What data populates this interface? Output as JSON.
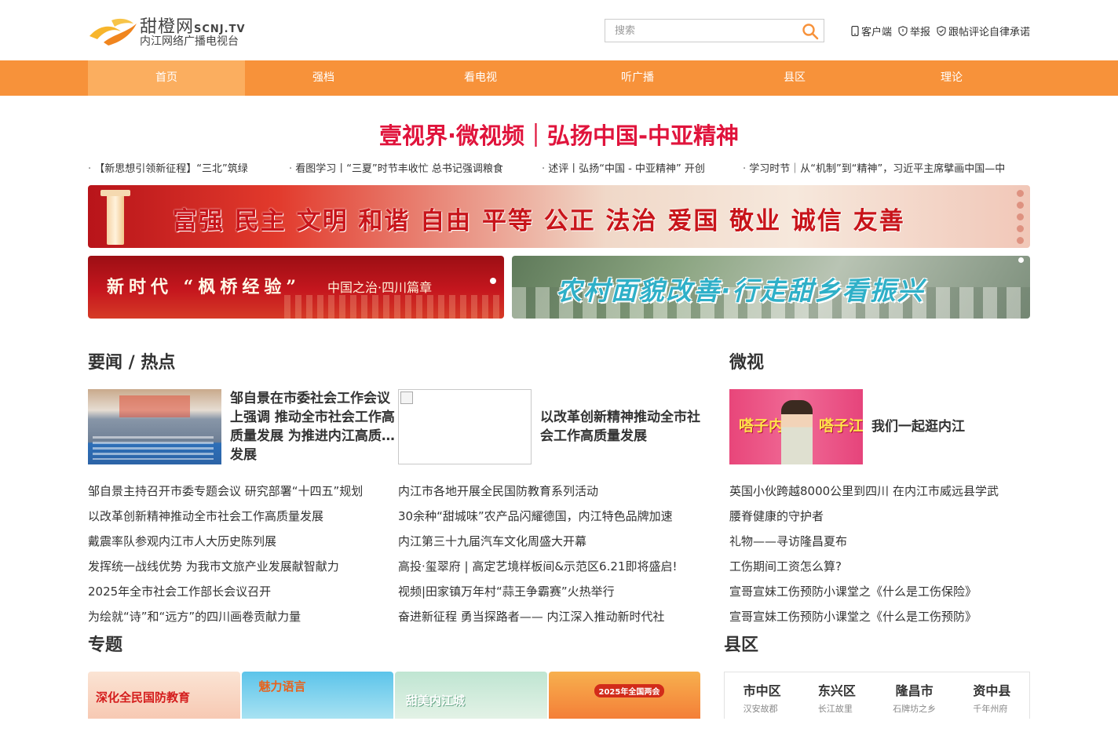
{
  "header": {
    "logo_name": "甜橙网",
    "logo_domain": "SCNJ.TV",
    "logo_subtitle": "内江网络广播电视台",
    "search_placeholder": "搜索",
    "links": [
      "客户端",
      "举报",
      "跟帖评论自律承诺"
    ]
  },
  "nav": {
    "items": [
      "首页",
      "强档",
      "看电视",
      "听广播",
      "县区",
      "理论"
    ],
    "active_index": 0
  },
  "headline": "壹视界·微视频｜弘扬中国-中亚精神",
  "ticker": [
    "【新思想引领新征程】“三北”筑绿",
    "看图学习丨“三夏”时节丰收忙 总书记强调粮食",
    "述评丨弘扬“中国 - 中亚精神” 开创",
    "学习时节｜从“机制”到“精神”，习近平主席擘画中国—中"
  ],
  "banners": {
    "values": "富强 民主 文明 和谐 自由 平等 公正 法治 爱国 敬业 诚信 友善",
    "fengqiao_main": "新时代 “枫桥经验”",
    "fengqiao_sub": "中国之治·四川篇章",
    "rural": "农村面貌改善·行走甜乡看振兴"
  },
  "news": {
    "title": "要闻 / 热点",
    "features": [
      "邹自景在市委社会工作会议上强调 推动全市社会工作高质量发展 为推进内江高质量发展",
      "以改革创新精神推动全市社会工作高质量发展"
    ],
    "list_left": [
      "邹自景主持召开市委专题会议 研究部署“十四五”规划",
      "以改革创新精神推动全市社会工作高质量发展",
      "戴震率队参观内江市人大历史陈列展",
      "发挥统一战线优势 为我市文旅产业发展献智献力",
      "2025年全市社会工作部长会议召开",
      "为绘就“诗”和“远方”的四川画卷贡献力量"
    ],
    "list_right": [
      "内江市各地开展全民国防教育系列活动",
      "30余种“甜城味”农产品闪耀德国，内江特色品牌加速",
      "内江第三十九届汽车文化周盛大开幕",
      "高投·玺翠府 | 高定艺境样板间&示范区6.21即将盛启!",
      "视频|田家镇万年村“蒜王争霸赛”火热举行",
      "奋进新征程 勇当探路者—— 内江深入推动新时代社"
    ]
  },
  "micro": {
    "title": "微视",
    "feature_title": "我们一起逛内江",
    "thumb_left": "嗒子内",
    "thumb_right": "嗒子江",
    "list": [
      "英国小伙跨越8000公里到四川 在内江市威远县学武",
      "腰脊健康的守护者",
      "礼物——寻访隆昌夏布",
      "工伤期间工资怎么算?",
      "宣哥宣妹工伤预防小课堂之《什么是工伤保险》",
      "宣哥宣妹工伤预防小课堂之《什么是工伤预防》"
    ]
  },
  "topics": {
    "title": "专题",
    "cards": [
      "深化全民国防教育",
      "魅力语言",
      "甜美内江城",
      "2025年全国两会"
    ]
  },
  "county": {
    "title": "县区",
    "items": [
      {
        "name": "市中区",
        "sub": "汉安故郡"
      },
      {
        "name": "东兴区",
        "sub": "长江故里"
      },
      {
        "name": "隆昌市",
        "sub": "石牌坊之乡"
      },
      {
        "name": "资中县",
        "sub": "千年州府"
      }
    ]
  },
  "colors": {
    "nav": "#f7923a",
    "nav_active": "#fbae5f",
    "headline": "#e0143c",
    "search_icon": "#f7923a"
  }
}
